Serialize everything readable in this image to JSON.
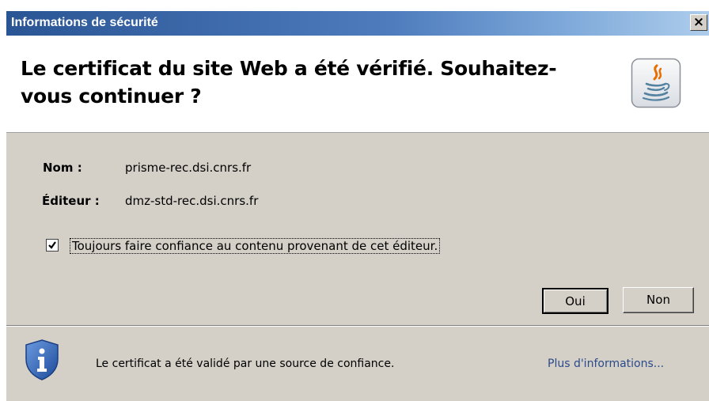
{
  "window": {
    "title": "Informations de sécurité",
    "close_label": "×"
  },
  "header": {
    "heading": "Le certificat du site Web a été vérifié.  Souhaitez-vous continuer ?",
    "icon": "java-icon"
  },
  "details": {
    "name_label": "Nom :",
    "name_value": "prisme-rec.dsi.cnrs.fr",
    "publisher_label": "Éditeur :",
    "publisher_value": "dmz-std-rec.dsi.cnrs.fr"
  },
  "trust_checkbox": {
    "label": "Toujours faire confiance au contenu provenant de cet éditeur.",
    "checked": true
  },
  "buttons": {
    "yes": "Oui",
    "no": "Non"
  },
  "footer": {
    "message": "Le certificat a été validé par une source de confiance.",
    "more_info": "Plus d'informations...",
    "icon": "info-shield-icon"
  },
  "colors": {
    "title_bar": "#2a5595",
    "dialog_bg": "#d4d0c8",
    "shield": "#2d5aa8",
    "link": "#2b4a8a"
  }
}
